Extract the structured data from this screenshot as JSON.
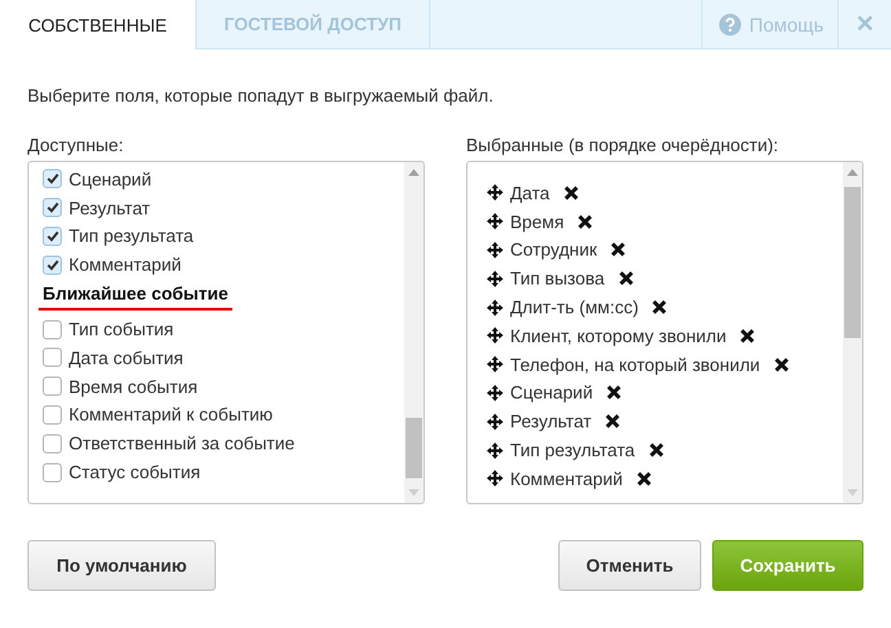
{
  "tabs": [
    {
      "label": "СОБСТВЕННЫЕ",
      "selected": true
    },
    {
      "label": "ГОСТЕВОЙ ДОСТУП",
      "selected": false
    }
  ],
  "help": {
    "label": "Помощь"
  },
  "close": "✕",
  "instruction": "Выберите поля, которые попадут в выгружаемый файл.",
  "available": {
    "label": "Доступные:",
    "items": [
      {
        "kind": "field",
        "label": "Сценарий",
        "checked": true
      },
      {
        "kind": "field",
        "label": "Результат",
        "checked": true
      },
      {
        "kind": "field",
        "label": "Тип результата",
        "checked": true
      },
      {
        "kind": "field",
        "label": "Комментарий",
        "checked": true
      },
      {
        "kind": "group",
        "label": "Ближайшее событие",
        "highlighted": true
      },
      {
        "kind": "field",
        "label": "Тип события",
        "checked": false
      },
      {
        "kind": "field",
        "label": "Дата события",
        "checked": false
      },
      {
        "kind": "field",
        "label": "Время события",
        "checked": false
      },
      {
        "kind": "field",
        "label": "Комментарий к событию",
        "checked": false
      },
      {
        "kind": "field",
        "label": "Ответственный за событие",
        "checked": false
      },
      {
        "kind": "field",
        "label": "Статус события",
        "checked": false
      }
    ]
  },
  "selected_fields": {
    "label": "Выбранные (в порядке очерёдности):",
    "items": [
      "Дата",
      "Время",
      "Сотрудник",
      "Тип вызова",
      "Длит-ть (мм:сс)",
      "Клиент, которому звонили",
      "Телефон, на который звонили",
      "Сценарий",
      "Результат",
      "Тип результата",
      "Комментарий"
    ]
  },
  "buttons": [
    {
      "kind": "default",
      "label": "По умолчанию"
    },
    {
      "kind": "secondary",
      "label": "Отменить"
    },
    {
      "kind": "primary",
      "label": "Сохранить"
    }
  ]
}
